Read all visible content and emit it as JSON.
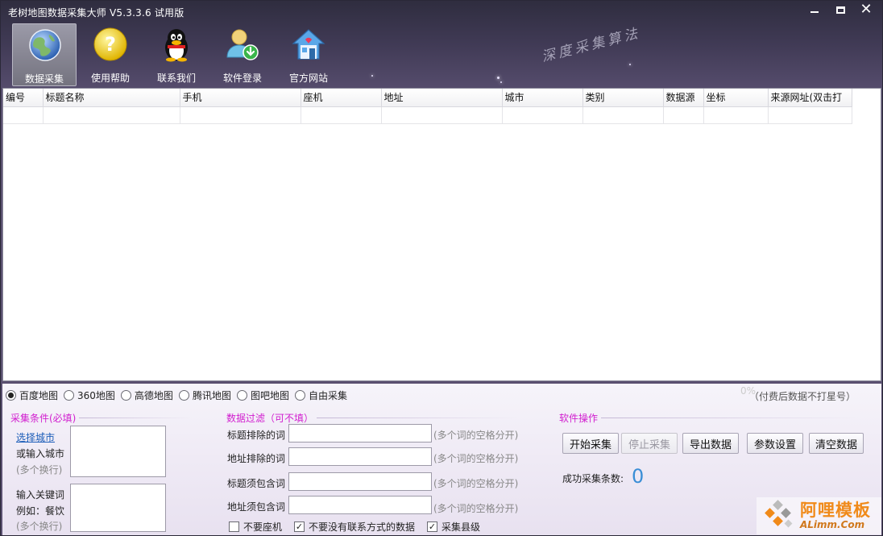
{
  "window": {
    "title": "老树地图数据采集大师 V5.3.3.6 试用版",
    "minimize_icon": "minimize-icon",
    "maximize_icon": "maximize-icon",
    "close_icon": "close-icon",
    "close_glyph": "✕"
  },
  "toolbar": {
    "items": [
      {
        "label": "数据采集",
        "icon": "globe-icon"
      },
      {
        "label": "使用帮助",
        "icon": "question-icon"
      },
      {
        "label": "联系我们",
        "icon": "qq-penguin-icon"
      },
      {
        "label": "软件登录",
        "icon": "user-download-icon"
      },
      {
        "label": "官方网站",
        "icon": "house-icon"
      }
    ]
  },
  "slogan": "深度采集算法",
  "grid": {
    "columns": [
      "编号",
      "标题名称",
      "手机",
      "座机",
      "地址",
      "城市",
      "类别",
      "数据源",
      "坐标",
      "来源网址(双击打"
    ]
  },
  "sources": {
    "options": [
      "百度地图",
      "360地图",
      "高德地图",
      "腾讯地图",
      "图吧地图",
      "自由采集"
    ],
    "selected": "百度地图",
    "note": "（付费后数据不打星号）",
    "faint_mark": "0%"
  },
  "conditions": {
    "title": "采集条件(必填)",
    "choose_city": "选择城市",
    "or_input_city": "或输入城市",
    "multi_line_1": "(多个换行)",
    "keyword_label": "输入关键词",
    "keyword_example": "例如：餐饮",
    "multi_line_2": "(多个换行)"
  },
  "filters": {
    "title": "数据过滤（可不填）",
    "rows": [
      {
        "label": "标题排除的词",
        "hint": "(多个词的空格分开)",
        "value": ""
      },
      {
        "label": "地址排除的词",
        "hint": "(多个词的空格分开)",
        "value": ""
      },
      {
        "label": "标题须包含词",
        "hint": "(多个词的空格分开)",
        "value": ""
      },
      {
        "label": "地址须包含词",
        "hint": "(多个词的空格分开)",
        "value": ""
      }
    ],
    "checkboxes": [
      {
        "label": "不要座机",
        "checked": false
      },
      {
        "label": "不要没有联系方式的数据",
        "checked": true
      },
      {
        "label": "采集县级",
        "checked": true
      }
    ],
    "check_glyph": "✓"
  },
  "operations": {
    "title": "软件操作",
    "buttons": {
      "start": "开始采集",
      "stop": "停止采集",
      "export": "导出数据",
      "settings": "参数设置",
      "clear": "清空数据"
    },
    "success_label": "成功采集条数:",
    "success_count": "0"
  },
  "watermark": {
    "text": "阿哩模板",
    "sub": "ALimm.Com"
  },
  "colors": {
    "section_title": "#d11ecf",
    "count": "#3a8ed6",
    "link": "#1a5cb8"
  }
}
